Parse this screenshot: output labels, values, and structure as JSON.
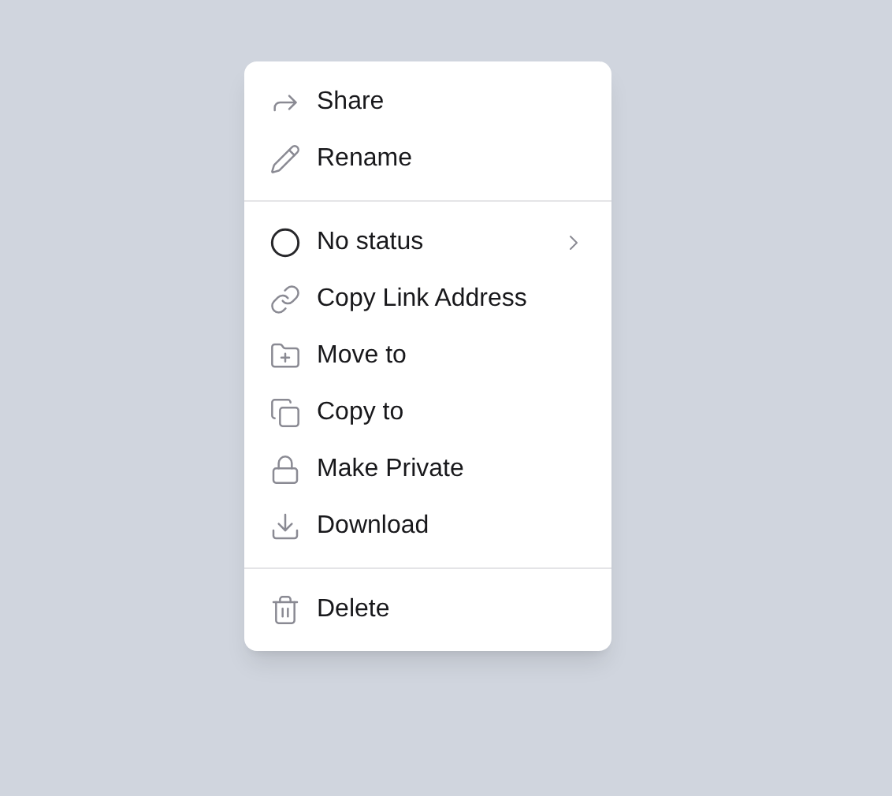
{
  "menu": {
    "groups": [
      {
        "items": [
          {
            "label": "Share",
            "has_submenu": false
          },
          {
            "label": "Rename",
            "has_submenu": false
          }
        ]
      },
      {
        "items": [
          {
            "label": "No status",
            "has_submenu": true
          },
          {
            "label": "Copy Link Address",
            "has_submenu": false
          },
          {
            "label": "Move to",
            "has_submenu": false
          },
          {
            "label": "Copy to",
            "has_submenu": false
          },
          {
            "label": "Make Private",
            "has_submenu": false
          },
          {
            "label": "Download",
            "has_submenu": false
          }
        ]
      },
      {
        "items": [
          {
            "label": "Delete",
            "has_submenu": false
          }
        ]
      }
    ]
  }
}
